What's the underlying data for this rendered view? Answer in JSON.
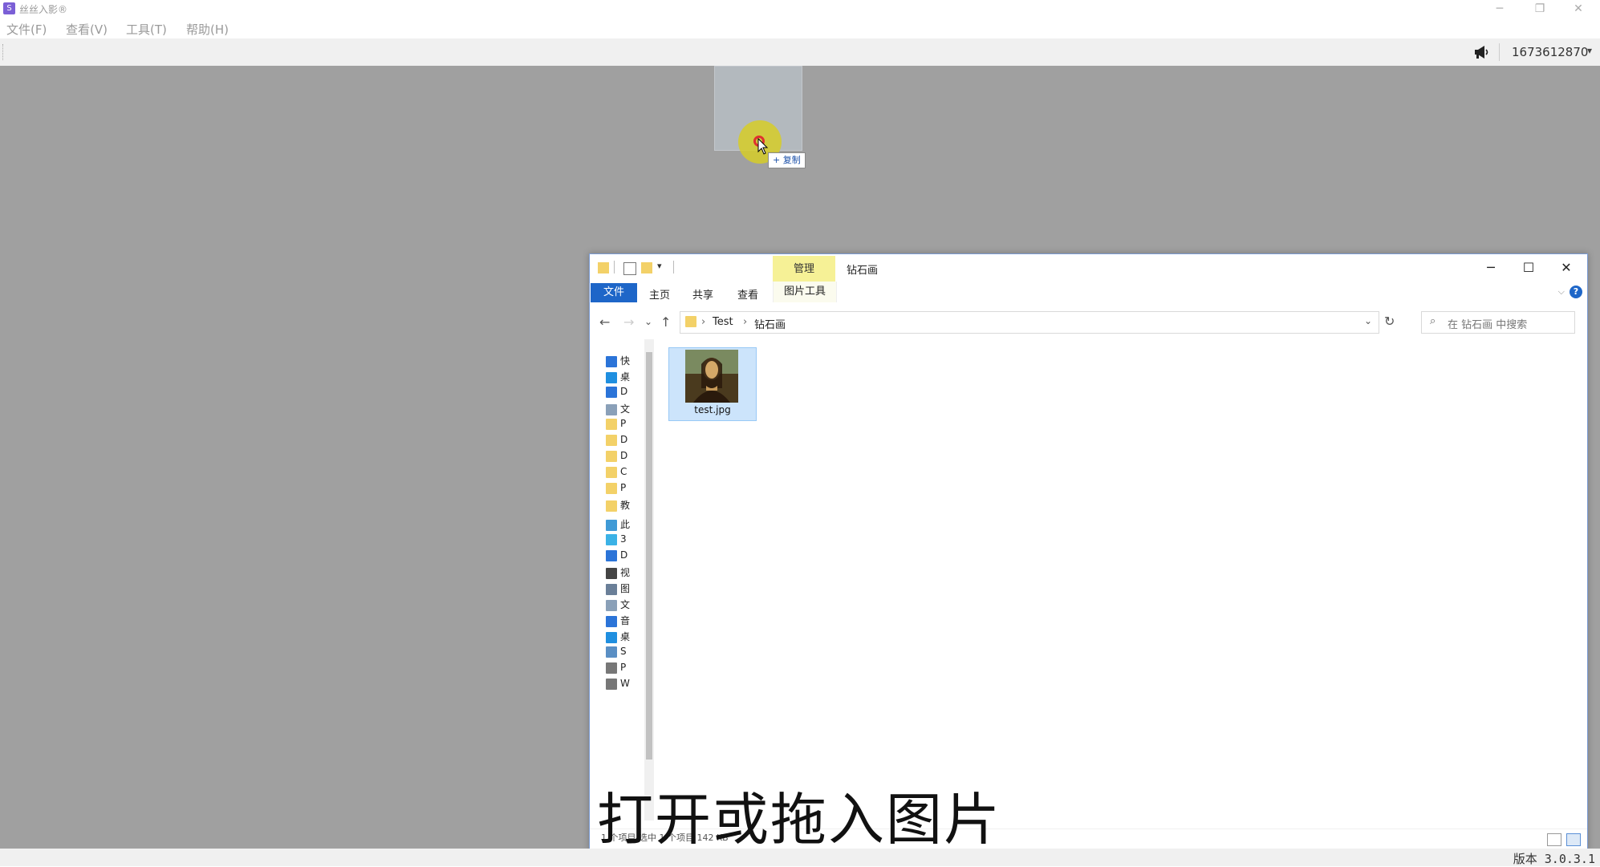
{
  "app": {
    "title": "丝丝入影®",
    "icon_glyph": "S",
    "window_controls": {
      "minimize": "─",
      "restore": "❐",
      "close": "✕"
    }
  },
  "menu": {
    "items": [
      "文件(F)",
      "查看(V)",
      "工具(T)",
      "帮助(H)"
    ]
  },
  "toolbar": {
    "user_id": "1673612870",
    "dropdown_glyph": "▾",
    "announce_icon": "megaphone-icon"
  },
  "drag": {
    "copy_label": "+ 复制"
  },
  "explorer": {
    "manage_tab": "管理",
    "title": "钻石画",
    "window_controls": {
      "minimize": "─",
      "maximize": "☐",
      "close": "✕"
    },
    "ribbon_tabs": [
      "文件",
      "主页",
      "共享",
      "查看"
    ],
    "picture_tools": "图片工具",
    "ribbon_expand": "⌵",
    "help": "?",
    "nav": {
      "back": "←",
      "forward": "→",
      "recent": "⌄",
      "up": "↑"
    },
    "breadcrumbs": [
      "Test",
      "钻石画"
    ],
    "crumb_sep": "›",
    "address_dropdown": "⌄",
    "refresh": "↻",
    "search_icon": "⌕",
    "search_placeholder": "在 钻石画 中搜索",
    "nav_pane": [
      {
        "icon": "star-icon",
        "label": "快",
        "color": "#2b74d8"
      },
      {
        "icon": "desktop-icon",
        "label": "桌",
        "color": "#1f8fe0"
      },
      {
        "icon": "download-icon",
        "label": "D",
        "color": "#2b74d8"
      },
      {
        "icon": "document-icon",
        "label": "文",
        "color": "#8aa0b8"
      },
      {
        "icon": "folder-icon",
        "label": "P",
        "color": "#f3d168"
      },
      {
        "icon": "folder-icon",
        "label": "D",
        "color": "#f3d168"
      },
      {
        "icon": "folder-icon",
        "label": "D",
        "color": "#f3d168"
      },
      {
        "icon": "folder-icon",
        "label": "C",
        "color": "#f3d168"
      },
      {
        "icon": "folder-icon",
        "label": "P",
        "color": "#f3d168"
      },
      {
        "icon": "folder-icon",
        "label": "教",
        "color": "#f3d168"
      },
      {
        "icon": "computer-icon",
        "label": "此",
        "color": "#3f9ad6"
      },
      {
        "icon": "3d-objects-icon",
        "label": "3",
        "color": "#3bb2e6"
      },
      {
        "icon": "download-icon",
        "label": "D",
        "color": "#2b74d8"
      },
      {
        "icon": "video-icon",
        "label": "视",
        "color": "#444"
      },
      {
        "icon": "pictures-icon",
        "label": "图",
        "color": "#6a7f98"
      },
      {
        "icon": "document-icon",
        "label": "文",
        "color": "#8aa0b8"
      },
      {
        "icon": "music-icon",
        "label": "音",
        "color": "#2b74d8"
      },
      {
        "icon": "desktop-icon",
        "label": "桌",
        "color": "#1f8fe0"
      },
      {
        "icon": "system-drive-icon",
        "label": "S",
        "color": "#5a8fc4"
      },
      {
        "icon": "drive-icon",
        "label": "P",
        "color": "#777"
      },
      {
        "icon": "drive-icon",
        "label": "W",
        "color": "#777"
      }
    ],
    "file": {
      "name": "test.jpg"
    },
    "status_text": "1 个项目   选中 1 个项目  142 KB"
  },
  "caption": "打开或拖入图片",
  "status": {
    "version": "版本 3.0.3.1"
  }
}
